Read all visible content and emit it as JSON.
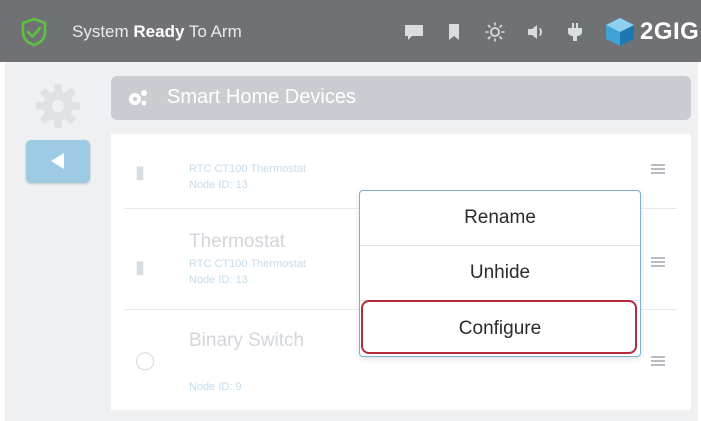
{
  "status_bar": {
    "status_prefix": "System ",
    "status_bold": "Ready",
    "status_suffix": " To Arm",
    "icons": [
      "shield-check-icon",
      "message-icon",
      "bookmark-icon",
      "brightness-icon",
      "volume-icon",
      "power-plug-icon"
    ],
    "brand": "2GIG"
  },
  "sidebar": {
    "icons": [
      "gear-icon",
      "back-arrow-icon"
    ]
  },
  "section": {
    "title": "Smart Home Devices",
    "icon": "smart-home-devices-icon"
  },
  "devices": [
    {
      "title": "",
      "subtitle": "RTC CT100 Thermostat",
      "detail": "Node ID: 13"
    },
    {
      "title": "Thermostat",
      "subtitle": "RTC CT100 Thermostat",
      "detail": "Node ID: 13"
    },
    {
      "title": "Binary Switch",
      "subtitle": "",
      "detail": "Node ID: 9"
    }
  ],
  "context_menu": {
    "items": [
      "Rename",
      "Unhide",
      "Configure"
    ],
    "highlighted": "Configure"
  },
  "colors": {
    "top_bar": "#6f7174",
    "accent_green": "#5ec23e",
    "back_button": "#9ccbe3",
    "highlight_border": "#b42b3c"
  }
}
